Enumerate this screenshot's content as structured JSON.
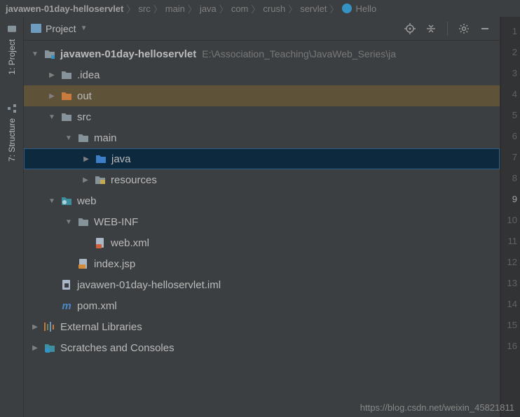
{
  "breadcrumb": {
    "items": [
      "javawen-01day-helloservlet",
      "src",
      "main",
      "java",
      "com",
      "crush",
      "servlet"
    ],
    "file": "Hello"
  },
  "sidebar": {
    "tabs": [
      {
        "label": "1: Project"
      },
      {
        "label": "7: Structure"
      }
    ]
  },
  "panel": {
    "title": "Project"
  },
  "tree": {
    "root": {
      "name": "javawen-01day-helloservlet",
      "path": "E:\\Association_Teaching\\JavaWeb_Series\\ja"
    },
    "nodes": {
      "idea": ".idea",
      "out": "out",
      "src": "src",
      "main": "main",
      "java": "java",
      "resources": "resources",
      "web": "web",
      "webinf": "WEB-INF",
      "webxml": "web.xml",
      "indexjsp": "index.jsp",
      "iml": "javawen-01day-helloservlet.iml",
      "pom": "pom.xml",
      "extlib": "External Libraries",
      "scratches": "Scratches and Consoles"
    }
  },
  "gutter": {
    "lines": [
      "1",
      "2",
      "3",
      "4",
      "5",
      "6",
      "7",
      "8",
      "9",
      "10",
      "11",
      "12",
      "13",
      "14",
      "15",
      "16"
    ],
    "current": 9
  },
  "watermark": "https://blog.csdn.net/weixin_45821811"
}
